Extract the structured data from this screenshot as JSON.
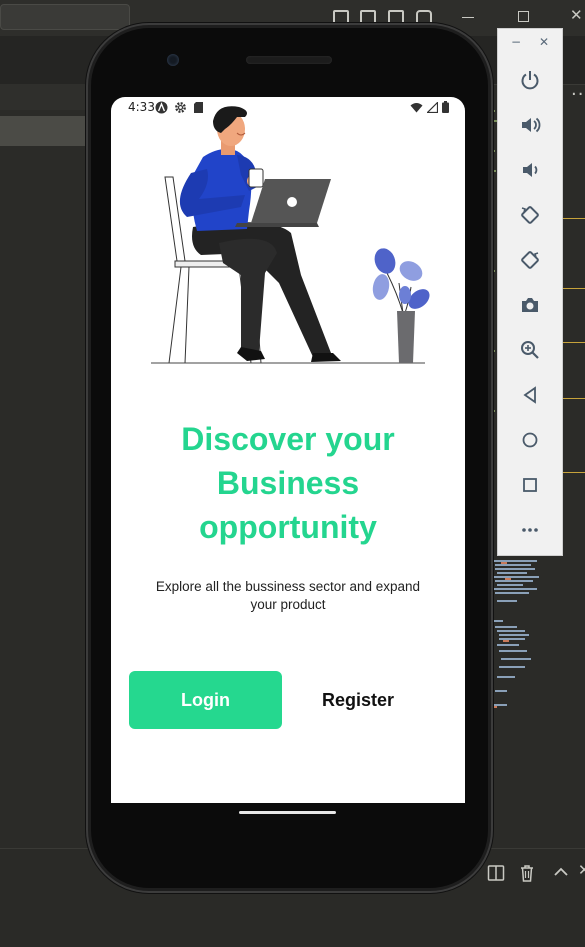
{
  "ide": {
    "toolbar_icons": [
      "layout-left-icon",
      "layout-bottom-icon",
      "layout-right-icon",
      "layout-custom-icon"
    ],
    "window_controls": [
      "minimize-icon",
      "restore-icon",
      "close-icon"
    ],
    "bottom_icons": [
      "split-editor-icon",
      "trash-icon",
      "chevron-up-icon",
      "close-icon"
    ]
  },
  "phone": {
    "status_bar": {
      "time": "4:33",
      "left_icons": [
        "android-a-icon",
        "settings-gear-icon",
        "sd-card-icon"
      ],
      "right_icons": [
        "wifi-icon",
        "signal-icon",
        "battery-icon"
      ]
    },
    "onboarding": {
      "headline_lines": [
        "Discover your",
        "Business",
        "opportunity"
      ],
      "subtitle": "Explore all the bussiness sector and expand your product",
      "login_label": "Login",
      "register_label": "Register"
    },
    "colors": {
      "accent": "#25d88f",
      "headline": "#24d58f",
      "shirt": "#2144c9",
      "pants": "#222222",
      "plant_leaf": "#6c7fd6"
    }
  },
  "emulator_panel": {
    "window": [
      "minimize-icon",
      "close-icon"
    ],
    "controls": [
      "power-icon",
      "volume-up-icon",
      "volume-down-icon",
      "rotate-left-icon",
      "rotate-right-icon",
      "camera-icon",
      "zoom-icon",
      "back-icon",
      "home-icon",
      "overview-icon",
      "more-icon"
    ]
  }
}
